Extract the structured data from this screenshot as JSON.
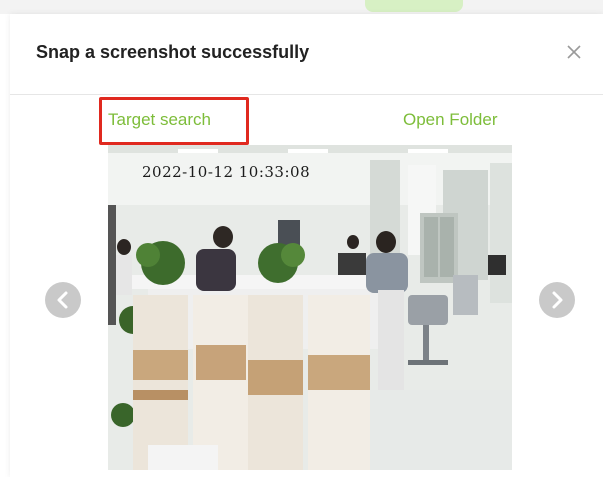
{
  "dialog": {
    "title": "Snap a screenshot successfully",
    "close_icon": "close-icon"
  },
  "actions": {
    "target_search_label": "Target search",
    "open_folder_label": "Open Folder"
  },
  "snapshot": {
    "timestamp": "2022-10-12 10:33:08",
    "description_icon": "camera-snapshot-image"
  },
  "navigation": {
    "prev_icon": "chevron-left-icon",
    "next_icon": "chevron-right-icon"
  },
  "colors": {
    "link_green": "#7dbd3a",
    "highlight_red": "#e0291f",
    "nav_gray": "#c9c9c9",
    "title_text": "#222222"
  }
}
